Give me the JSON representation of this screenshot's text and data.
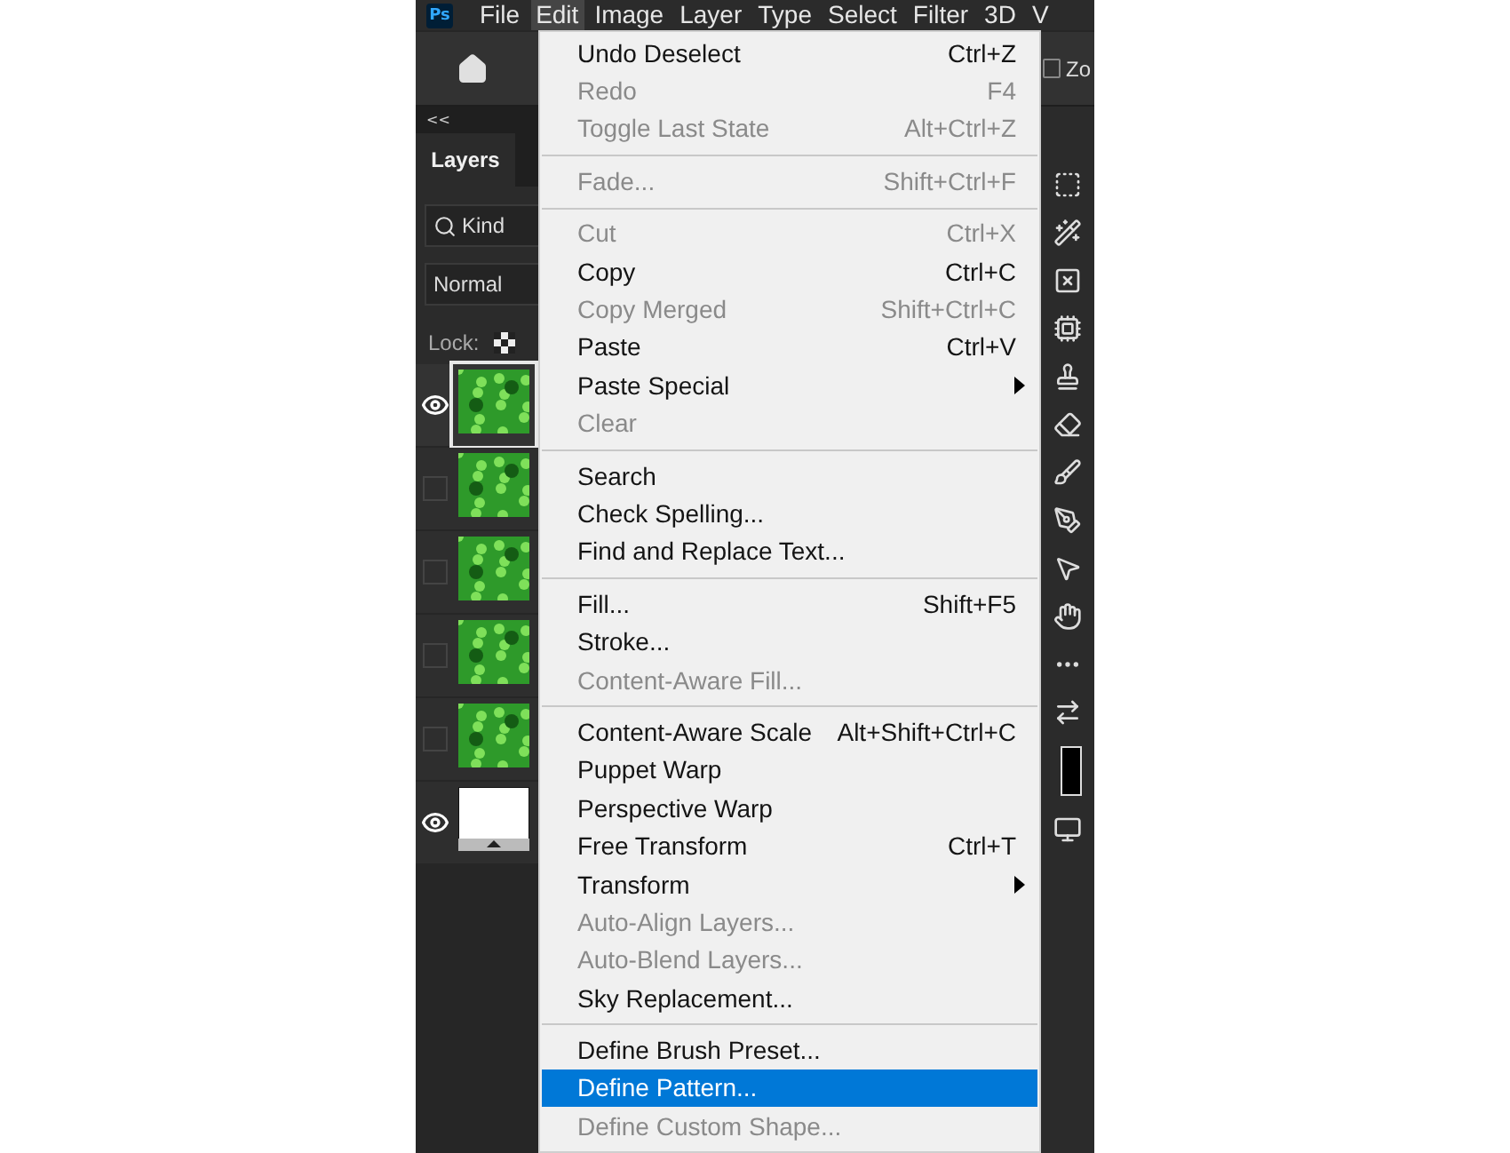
{
  "menubar": {
    "logo": "Ps",
    "items": [
      {
        "label": "File",
        "selected": false
      },
      {
        "label": "Edit",
        "selected": true
      },
      {
        "label": "Image",
        "selected": false
      },
      {
        "label": "Layer",
        "selected": false
      },
      {
        "label": "Type",
        "selected": false
      },
      {
        "label": "Select",
        "selected": false
      },
      {
        "label": "Filter",
        "selected": false
      },
      {
        "label": "3D",
        "selected": false
      },
      {
        "label": "V",
        "selected": false
      }
    ]
  },
  "options_bar": {
    "zoom_checked": false,
    "zoom_label": "Zo"
  },
  "layers_panel": {
    "collapse": "<<",
    "tab": "Layers",
    "filter": "Kind",
    "blend_mode": "Normal",
    "lock_label": "Lock:",
    "layers": [
      {
        "visible": true,
        "selected": true,
        "kind": "texture"
      },
      {
        "visible": false,
        "selected": false,
        "kind": "texture"
      },
      {
        "visible": false,
        "selected": false,
        "kind": "texture"
      },
      {
        "visible": false,
        "selected": false,
        "kind": "texture"
      },
      {
        "visible": false,
        "selected": false,
        "kind": "texture"
      },
      {
        "visible": true,
        "selected": false,
        "kind": "blank"
      }
    ]
  },
  "edit_menu": {
    "sections": [
      [
        {
          "label": "Undo Deselect",
          "shortcut": "Ctrl+Z",
          "disabled": false,
          "submenu": false,
          "selected": false
        },
        {
          "label": "Redo",
          "shortcut": "F4",
          "disabled": true,
          "submenu": false,
          "selected": false
        },
        {
          "label": "Toggle Last State",
          "shortcut": "Alt+Ctrl+Z",
          "disabled": true,
          "submenu": false,
          "selected": false
        }
      ],
      [
        {
          "label": "Fade...",
          "shortcut": "Shift+Ctrl+F",
          "disabled": true,
          "submenu": false,
          "selected": false
        }
      ],
      [
        {
          "label": "Cut",
          "shortcut": "Ctrl+X",
          "disabled": true,
          "submenu": false,
          "selected": false
        },
        {
          "label": "Copy",
          "shortcut": "Ctrl+C",
          "disabled": false,
          "submenu": false,
          "selected": false
        },
        {
          "label": "Copy Merged",
          "shortcut": "Shift+Ctrl+C",
          "disabled": true,
          "submenu": false,
          "selected": false
        },
        {
          "label": "Paste",
          "shortcut": "Ctrl+V",
          "disabled": false,
          "submenu": false,
          "selected": false
        },
        {
          "label": "Paste Special",
          "disabled": false,
          "submenu": true,
          "selected": false
        },
        {
          "label": "Clear",
          "disabled": true,
          "submenu": false,
          "selected": false
        }
      ],
      [
        {
          "label": "Search",
          "disabled": false,
          "submenu": false,
          "selected": false
        },
        {
          "label": "Check Spelling...",
          "disabled": false,
          "submenu": false,
          "selected": false
        },
        {
          "label": "Find and Replace Text...",
          "disabled": false,
          "submenu": false,
          "selected": false
        }
      ],
      [
        {
          "label": "Fill...",
          "shortcut": "Shift+F5",
          "disabled": false,
          "submenu": false,
          "selected": false
        },
        {
          "label": "Stroke...",
          "disabled": false,
          "submenu": false,
          "selected": false
        },
        {
          "label": "Content-Aware Fill...",
          "disabled": true,
          "submenu": false,
          "selected": false
        }
      ],
      [
        {
          "label": "Content-Aware Scale",
          "shortcut": "Alt+Shift+Ctrl+C",
          "disabled": false,
          "submenu": false,
          "selected": false
        },
        {
          "label": "Puppet Warp",
          "disabled": false,
          "submenu": false,
          "selected": false
        },
        {
          "label": "Perspective Warp",
          "disabled": false,
          "submenu": false,
          "selected": false
        },
        {
          "label": "Free Transform",
          "shortcut": "Ctrl+T",
          "disabled": false,
          "submenu": false,
          "selected": false
        },
        {
          "label": "Transform",
          "disabled": false,
          "submenu": true,
          "selected": false
        },
        {
          "label": "Auto-Align Layers...",
          "disabled": true,
          "submenu": false,
          "selected": false
        },
        {
          "label": "Auto-Blend Layers...",
          "disabled": true,
          "submenu": false,
          "selected": false
        },
        {
          "label": "Sky Replacement...",
          "disabled": false,
          "submenu": false,
          "selected": false
        }
      ],
      [
        {
          "label": "Define Brush Preset...",
          "disabled": false,
          "submenu": false,
          "selected": false
        },
        {
          "label": "Define Pattern...",
          "disabled": false,
          "submenu": false,
          "selected": true
        },
        {
          "label": "Define Custom Shape...",
          "disabled": true,
          "submenu": false,
          "selected": false
        }
      ]
    ]
  }
}
